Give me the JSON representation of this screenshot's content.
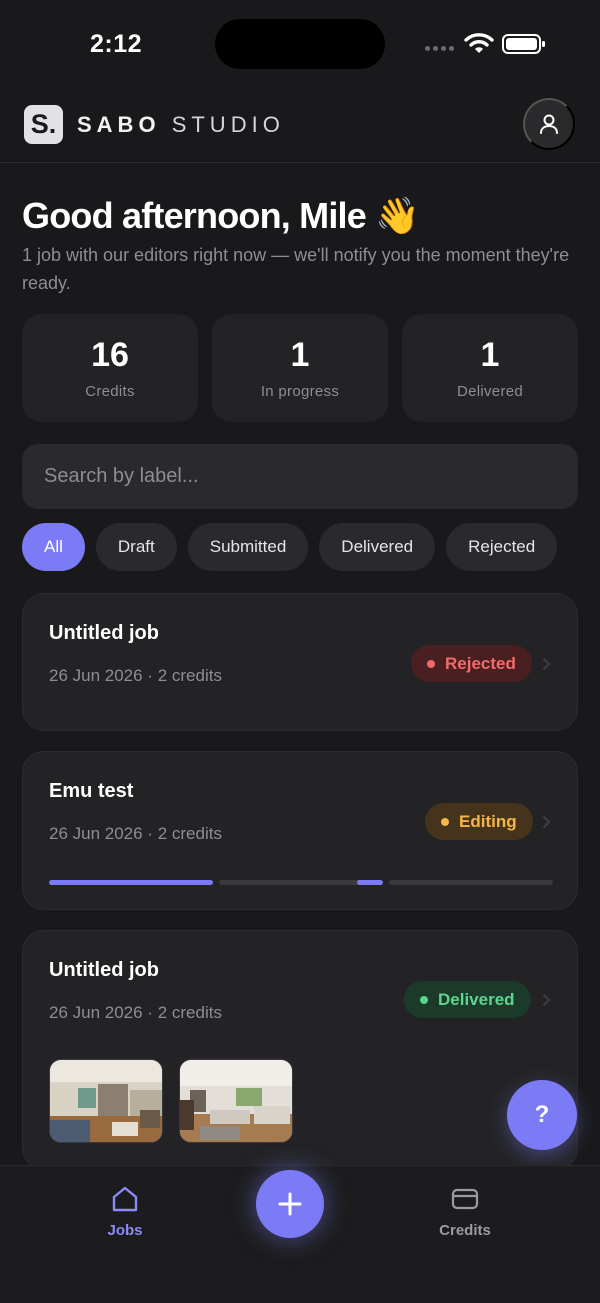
{
  "status_bar": {
    "time": "2:12"
  },
  "header": {
    "logo_letter": "S.",
    "brand_bold": "SABO",
    "brand_light": "STUDIO"
  },
  "greeting": {
    "title": "Good afternoon, Mile 👋",
    "subtitle": "1 job with our editors right now — we'll notify you the moment they're ready."
  },
  "stats": [
    {
      "value": "16",
      "label": "Credits"
    },
    {
      "value": "1",
      "label": "In progress"
    },
    {
      "value": "1",
      "label": "Delivered"
    }
  ],
  "search": {
    "placeholder": "Search by label..."
  },
  "filters": {
    "active": "All",
    "items": [
      "All",
      "Draft",
      "Submitted",
      "Delivered",
      "Rejected"
    ]
  },
  "jobs": [
    {
      "title": "Untitled job",
      "meta": "26 Jun 2026 · 2 credits",
      "status": "Rejected"
    },
    {
      "title": "Emu test",
      "meta": "26 Jun 2026 · 2 credits",
      "status": "Editing",
      "progress_segments": 3,
      "progress_active": [
        1,
        2
      ]
    },
    {
      "title": "Untitled job",
      "meta": "26 Jun 2026 · 2 credits",
      "status": "Delivered",
      "thumbnails": 2
    }
  ],
  "help": {
    "label": "?"
  },
  "bottom_nav": {
    "jobs": {
      "label": "Jobs",
      "icon": "home-icon"
    },
    "add": {
      "icon": "plus-icon"
    },
    "credits": {
      "label": "Credits",
      "icon": "card-icon"
    }
  },
  "colors": {
    "accent": "#7b7bf5",
    "background": "#19191b",
    "rejected": "#f26b6b",
    "editing": "#f5b547",
    "delivered": "#5ed58c"
  }
}
